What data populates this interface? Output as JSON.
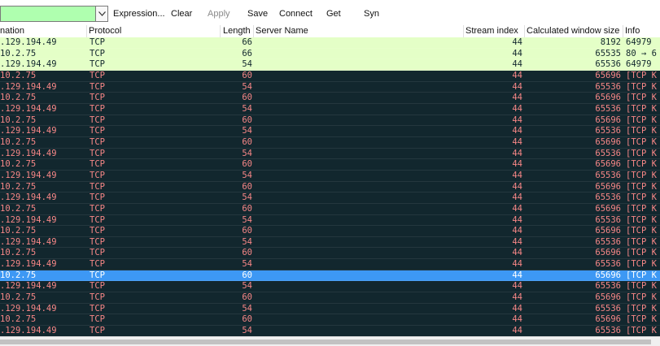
{
  "toolbar": {
    "filter_value": "",
    "expression_label": "Expression...",
    "clear_label": "Clear",
    "apply_label": "Apply",
    "save_label": "Save",
    "connect_label": "Connect",
    "get_label": "Get",
    "syn_label": "Syn"
  },
  "columns": {
    "destination": "nation",
    "protocol": "Protocol",
    "length": "Length",
    "server_name": "Server Name",
    "stream_index": "Stream index",
    "window_size": "Calculated window size",
    "info": "Info"
  },
  "colors": {
    "filter_valid": "#afffaf",
    "row_green": "#e4ffc7",
    "row_black_bg": "#12272e",
    "row_black_fg": "#f78787",
    "row_selected": "#3d98f4"
  },
  "rows": [
    {
      "dst": ".129.194.49",
      "proto": "TCP",
      "len": "66",
      "srv": "",
      "stream": "44",
      "win": "8192",
      "info": "64979",
      "style": "green"
    },
    {
      "dst": "10.2.75",
      "proto": "TCP",
      "len": "66",
      "srv": "",
      "stream": "44",
      "win": "65535",
      "info": "80 → 6",
      "style": "green"
    },
    {
      "dst": ".129.194.49",
      "proto": "TCP",
      "len": "54",
      "srv": "",
      "stream": "44",
      "win": "65536",
      "info": "64979",
      "style": "green"
    },
    {
      "dst": "10.2.75",
      "proto": "TCP",
      "len": "60",
      "srv": "",
      "stream": "44",
      "win": "65696",
      "info": "[TCP K",
      "style": "black"
    },
    {
      "dst": ".129.194.49",
      "proto": "TCP",
      "len": "54",
      "srv": "",
      "stream": "44",
      "win": "65536",
      "info": "[TCP K",
      "style": "black"
    },
    {
      "dst": "10.2.75",
      "proto": "TCP",
      "len": "60",
      "srv": "",
      "stream": "44",
      "win": "65696",
      "info": "[TCP K",
      "style": "black"
    },
    {
      "dst": ".129.194.49",
      "proto": "TCP",
      "len": "54",
      "srv": "",
      "stream": "44",
      "win": "65536",
      "info": "[TCP K",
      "style": "black"
    },
    {
      "dst": "10.2.75",
      "proto": "TCP",
      "len": "60",
      "srv": "",
      "stream": "44",
      "win": "65696",
      "info": "[TCP K",
      "style": "black"
    },
    {
      "dst": ".129.194.49",
      "proto": "TCP",
      "len": "54",
      "srv": "",
      "stream": "44",
      "win": "65536",
      "info": "[TCP K",
      "style": "black"
    },
    {
      "dst": "10.2.75",
      "proto": "TCP",
      "len": "60",
      "srv": "",
      "stream": "44",
      "win": "65696",
      "info": "[TCP K",
      "style": "black"
    },
    {
      "dst": ".129.194.49",
      "proto": "TCP",
      "len": "54",
      "srv": "",
      "stream": "44",
      "win": "65536",
      "info": "[TCP K",
      "style": "black"
    },
    {
      "dst": "10.2.75",
      "proto": "TCP",
      "len": "60",
      "srv": "",
      "stream": "44",
      "win": "65696",
      "info": "[TCP K",
      "style": "black"
    },
    {
      "dst": ".129.194.49",
      "proto": "TCP",
      "len": "54",
      "srv": "",
      "stream": "44",
      "win": "65536",
      "info": "[TCP K",
      "style": "black"
    },
    {
      "dst": "10.2.75",
      "proto": "TCP",
      "len": "60",
      "srv": "",
      "stream": "44",
      "win": "65696",
      "info": "[TCP K",
      "style": "black"
    },
    {
      "dst": ".129.194.49",
      "proto": "TCP",
      "len": "54",
      "srv": "",
      "stream": "44",
      "win": "65536",
      "info": "[TCP K",
      "style": "black"
    },
    {
      "dst": "10.2.75",
      "proto": "TCP",
      "len": "60",
      "srv": "",
      "stream": "44",
      "win": "65696",
      "info": "[TCP K",
      "style": "black"
    },
    {
      "dst": ".129.194.49",
      "proto": "TCP",
      "len": "54",
      "srv": "",
      "stream": "44",
      "win": "65536",
      "info": "[TCP K",
      "style": "black"
    },
    {
      "dst": "10.2.75",
      "proto": "TCP",
      "len": "60",
      "srv": "",
      "stream": "44",
      "win": "65696",
      "info": "[TCP K",
      "style": "black"
    },
    {
      "dst": ".129.194.49",
      "proto": "TCP",
      "len": "54",
      "srv": "",
      "stream": "44",
      "win": "65536",
      "info": "[TCP K",
      "style": "black"
    },
    {
      "dst": "10.2.75",
      "proto": "TCP",
      "len": "60",
      "srv": "",
      "stream": "44",
      "win": "65696",
      "info": "[TCP K",
      "style": "black"
    },
    {
      "dst": ".129.194.49",
      "proto": "TCP",
      "len": "54",
      "srv": "",
      "stream": "44",
      "win": "65536",
      "info": "[TCP K",
      "style": "black"
    },
    {
      "dst": "10.2.75",
      "proto": "TCP",
      "len": "60",
      "srv": "",
      "stream": "44",
      "win": "65696",
      "info": "[TCP K",
      "style": "sel"
    },
    {
      "dst": ".129.194.49",
      "proto": "TCP",
      "len": "54",
      "srv": "",
      "stream": "44",
      "win": "65536",
      "info": "[TCP K",
      "style": "black"
    },
    {
      "dst": "10.2.75",
      "proto": "TCP",
      "len": "60",
      "srv": "",
      "stream": "44",
      "win": "65696",
      "info": "[TCP K",
      "style": "black"
    },
    {
      "dst": ".129.194.49",
      "proto": "TCP",
      "len": "54",
      "srv": "",
      "stream": "44",
      "win": "65536",
      "info": "[TCP K",
      "style": "black"
    },
    {
      "dst": "10.2.75",
      "proto": "TCP",
      "len": "60",
      "srv": "",
      "stream": "44",
      "win": "65696",
      "info": "[TCP K",
      "style": "black"
    },
    {
      "dst": ".129.194.49",
      "proto": "TCP",
      "len": "54",
      "srv": "",
      "stream": "44",
      "win": "65536",
      "info": "[TCP K",
      "style": "black"
    }
  ]
}
